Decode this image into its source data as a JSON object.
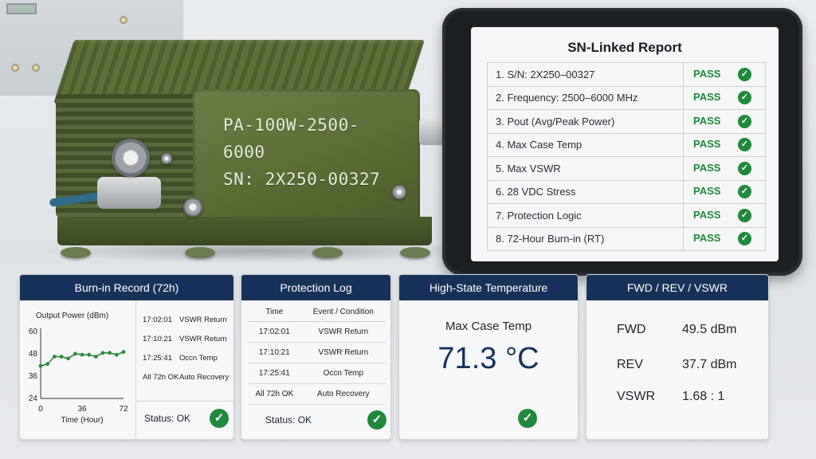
{
  "device": {
    "model": "PA-100W-2500-6000",
    "serial": "SN: 2X250-00327"
  },
  "report": {
    "title": "SN-Linked Report",
    "items": [
      {
        "label": "1.  S/N: 2X250–00327",
        "result": "PASS"
      },
      {
        "label": "2.  Frequency: 2500–6000 MHz",
        "result": "PASS"
      },
      {
        "label": "3.  Pout (Avg/Peak Power)",
        "result": "PASS"
      },
      {
        "label": "4.  Max Case Temp",
        "result": "PASS"
      },
      {
        "label": "5.  Max VSWR",
        "result": "PASS"
      },
      {
        "label": "6.  28 VDC Stress",
        "result": "PASS"
      },
      {
        "label": "7.  Protection Logic",
        "result": "PASS"
      },
      {
        "label": "8.  72-Hour Burn-in (RT)",
        "result": "PASS"
      }
    ],
    "check_icon": "check-circle-icon",
    "pass_color": "#1e8a3a"
  },
  "burnin": {
    "title": "Burn-in Record (72h)",
    "log": [
      {
        "time": "17:02:01",
        "event": "VSWR Return"
      },
      {
        "time": "17:10:21",
        "event": "VSWR Return"
      },
      {
        "time": "17:25:41",
        "event": "Occn Temp"
      },
      {
        "time": "All 72h OK",
        "event": "Auto Recovery"
      }
    ],
    "status_label": "Status:",
    "status_value": "OK"
  },
  "chart_data": {
    "type": "line",
    "title": "Output Power (dBm)",
    "xlabel": "Time (Hour)",
    "ylabel": "",
    "xlim": [
      0,
      72
    ],
    "ylim": [
      24,
      60
    ],
    "xticks": [
      0,
      36,
      72
    ],
    "yticks": [
      60,
      48,
      36,
      24
    ],
    "x": [
      0,
      6,
      12,
      18,
      24,
      30,
      36,
      42,
      48,
      54,
      60,
      66,
      72
    ],
    "values": [
      41.5,
      42.5,
      46.5,
      46.5,
      45.5,
      48,
      47.5,
      47.5,
      46.5,
      48.5,
      48.5,
      47.5,
      49
    ],
    "line_color": "#2e8b3e"
  },
  "protection": {
    "title": "Protection Log",
    "headers": [
      "Time",
      "Event / Condition"
    ],
    "rows": [
      [
        "17:02:01",
        "VSWR Return"
      ],
      [
        "17:10:21",
        "VSWR Return"
      ],
      [
        "17:25:41",
        "Occn Temp"
      ],
      [
        "All 72h OK",
        "Auto Recovery"
      ]
    ],
    "status_label": "Status:",
    "status_value": "OK"
  },
  "temperature": {
    "title": "High-State Temperature",
    "label": "Max Case Temp",
    "value": "71.3 °C"
  },
  "rf": {
    "title": "FWD / REV / VSWR",
    "rows": [
      {
        "key": "FWD",
        "value": "49.5 dBm"
      },
      {
        "key": "REV",
        "value": "37.7 dBm"
      },
      {
        "key": "VSWR",
        "value": "1.68 : 1"
      }
    ]
  },
  "colors": {
    "header_bg": "#17325a",
    "ok_green": "#1f8a3b"
  }
}
